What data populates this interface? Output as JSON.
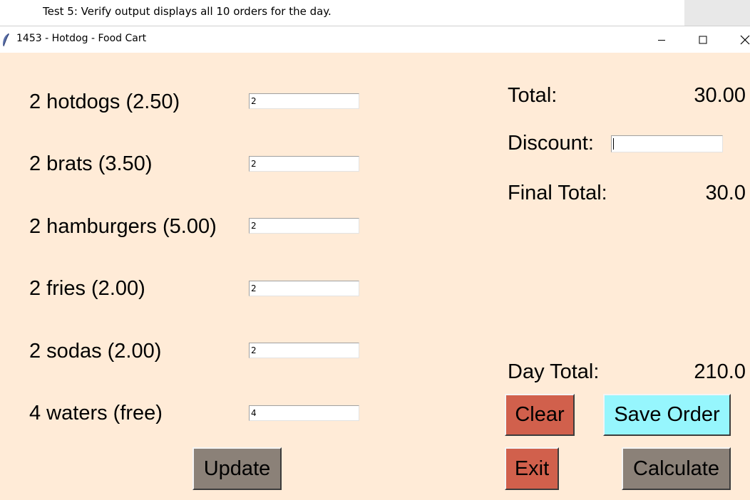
{
  "document": {
    "caption": "Test 5: Verify output displays all 10 orders for the day."
  },
  "window": {
    "title": "1453 - Hotdog - Food Cart",
    "icon": "feather-icon",
    "controls": {
      "minimize": "minimize-icon",
      "maximize": "maximize-icon",
      "close": "close-icon"
    }
  },
  "order": {
    "items": [
      {
        "label": "2 hotdogs (2.50)",
        "qty": "2"
      },
      {
        "label": "2 brats (3.50)",
        "qty": "2"
      },
      {
        "label": "2 hamburgers (5.00)",
        "qty": "2"
      },
      {
        "label": "2 fries (2.00)",
        "qty": "2"
      },
      {
        "label": "2 sodas (2.00)",
        "qty": "2"
      },
      {
        "label": "4 waters (free)",
        "qty": "4"
      }
    ],
    "update_label": "Update"
  },
  "summary": {
    "total_label": "Total:",
    "total_value": "30.00",
    "discount_label": "Discount:",
    "discount_value": "",
    "final_label": "Final Total:",
    "final_value": "30.0",
    "day_label": "Day Total:",
    "day_value": "210.0"
  },
  "buttons": {
    "clear": "Clear",
    "save": "Save Order",
    "exit": "Exit",
    "calculate": "Calculate"
  },
  "colors": {
    "background": "#ffebd7",
    "gray_button": "#8b8178",
    "red_button": "#d1604c",
    "cyan_button": "#96f6fd"
  }
}
